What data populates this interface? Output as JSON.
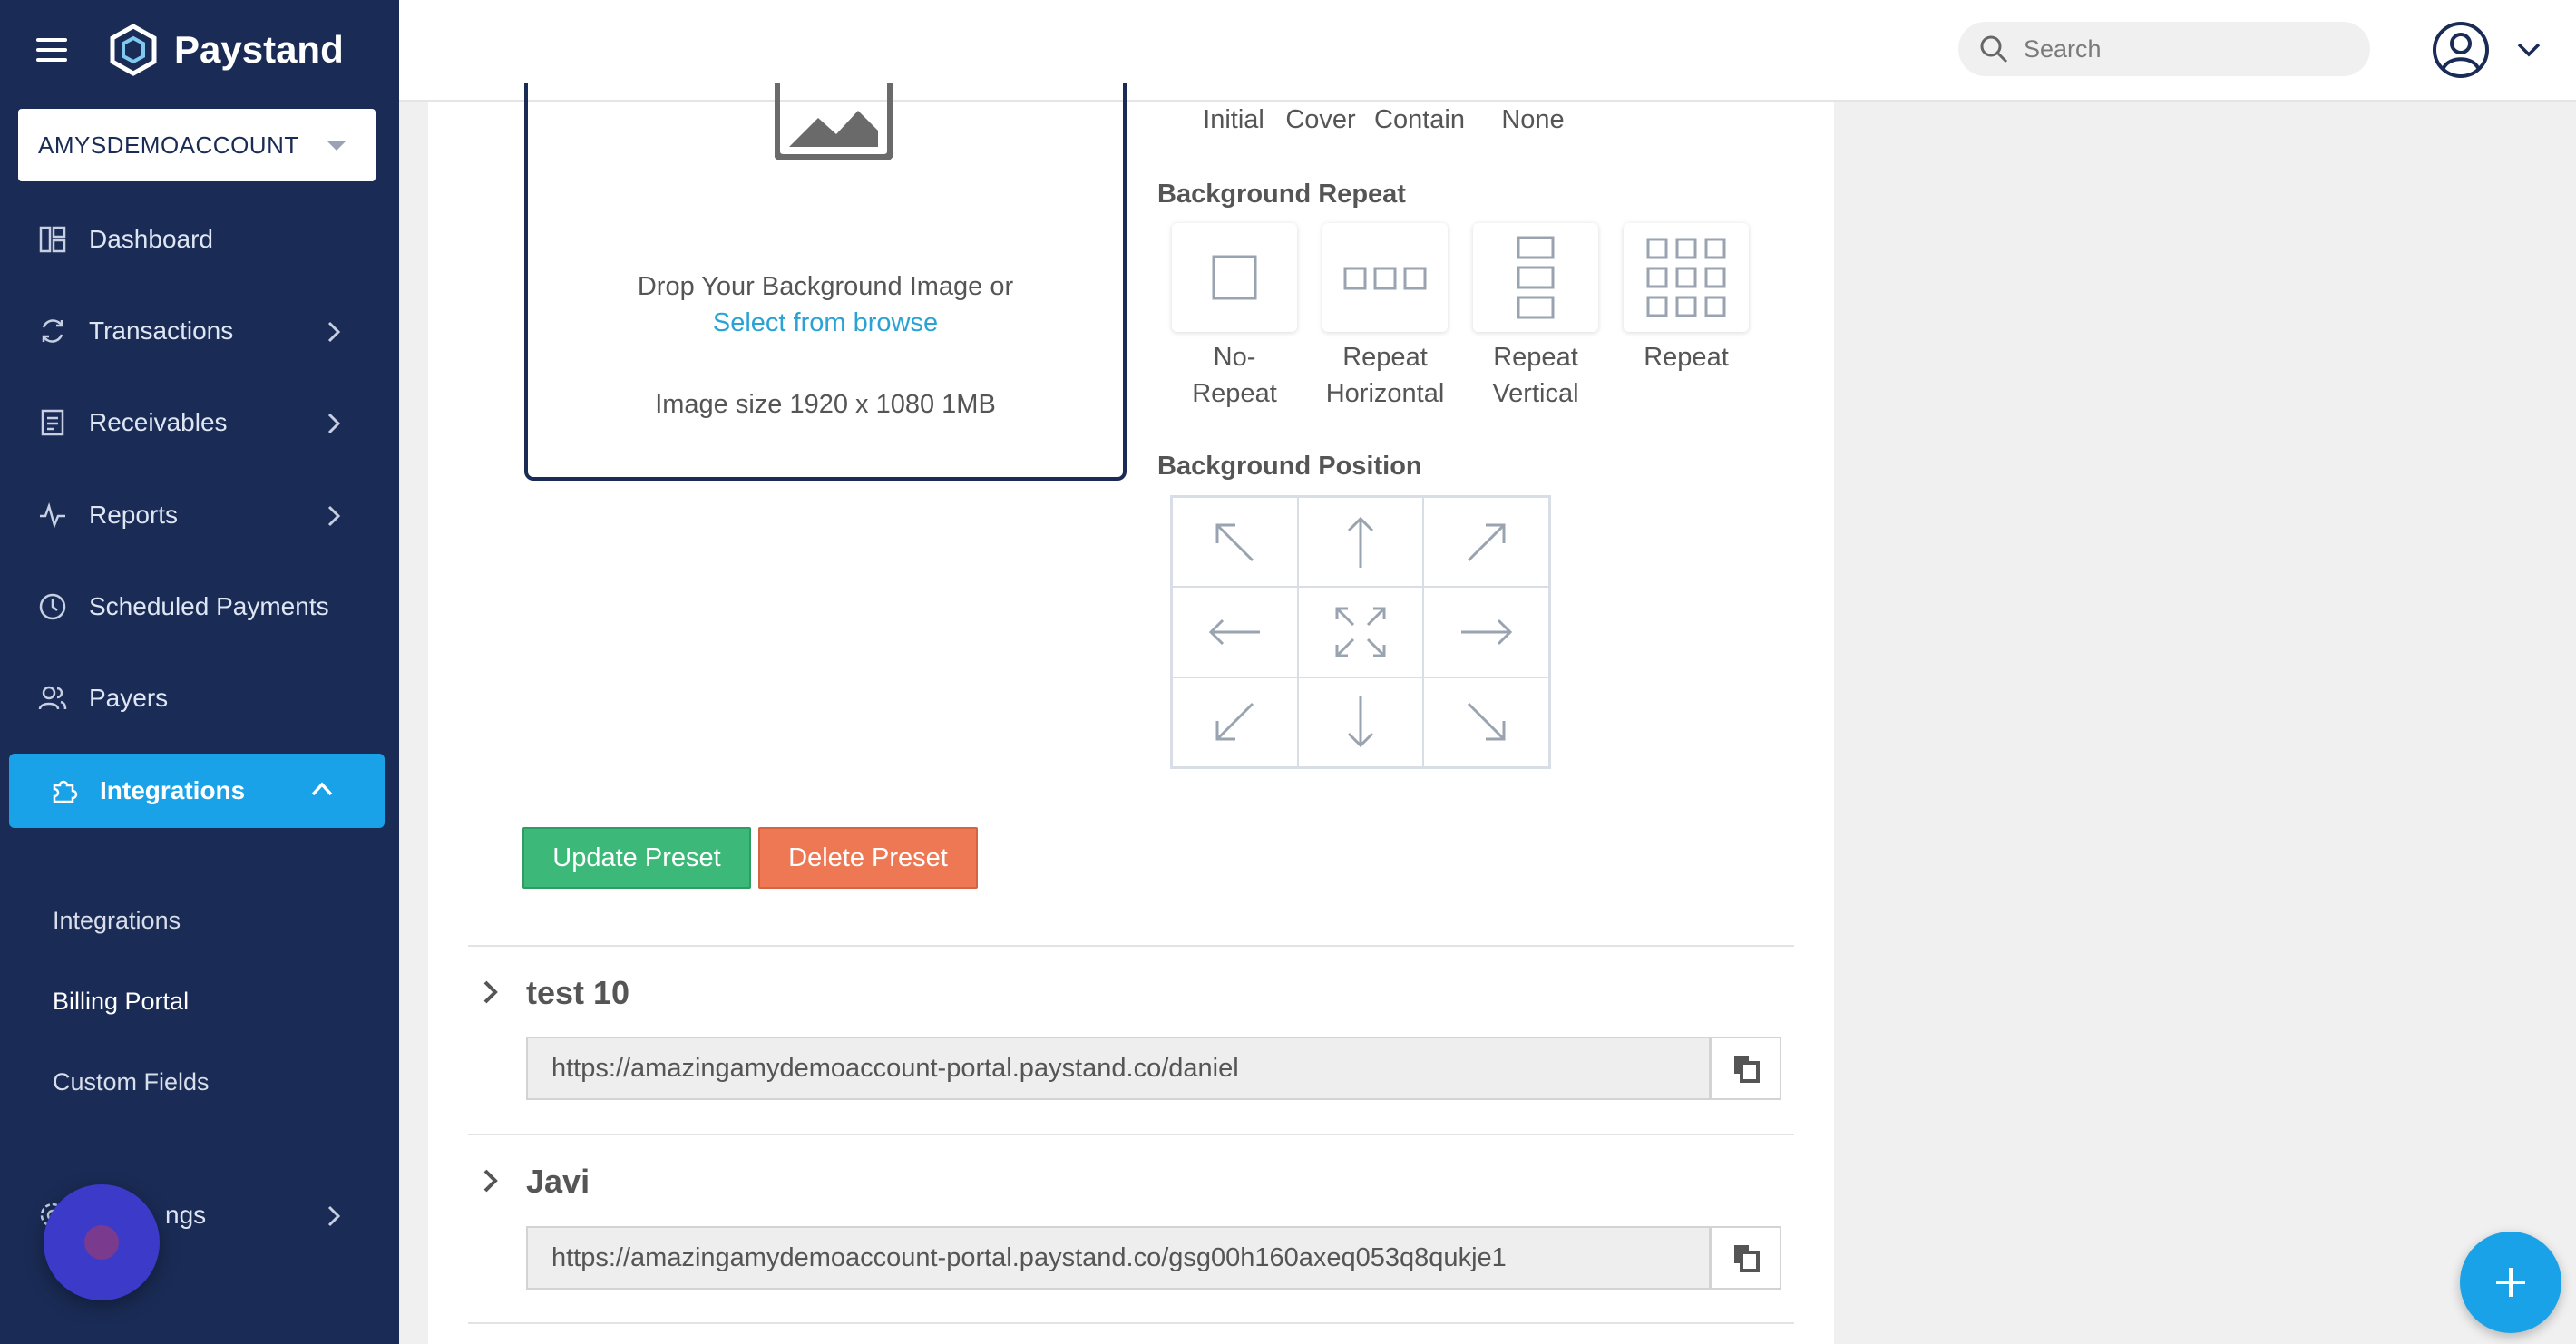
{
  "app": {
    "name": "Paystand"
  },
  "account": {
    "selected": "AMYSDEMOACCOUNT"
  },
  "sidebar": {
    "items": [
      {
        "label": "Dashboard",
        "icon": "dashboard-icon"
      },
      {
        "label": "Transactions",
        "icon": "refresh-icon"
      },
      {
        "label": "Receivables",
        "icon": "document-icon"
      },
      {
        "label": "Reports",
        "icon": "activity-icon"
      },
      {
        "label": "Scheduled Payments",
        "icon": "clock-icon"
      },
      {
        "label": "Payers",
        "icon": "users-icon"
      },
      {
        "label": "Integrations",
        "icon": "puzzle-icon"
      },
      {
        "label": "ngs",
        "icon": "gear-icon"
      }
    ],
    "sub_items": [
      "Integrations",
      "Billing Portal",
      "Custom Fields"
    ],
    "active_item": "Integrations",
    "current_sub_item": "Billing Portal"
  },
  "header": {
    "search_placeholder": "Search"
  },
  "dropzone": {
    "text": "Drop Your Background Image or",
    "link": "Select from browse",
    "size_note": "Image size 1920 x 1080 1MB"
  },
  "background_size": {
    "options": [
      "Initial",
      "Cover",
      "Contain",
      "None"
    ]
  },
  "background_repeat": {
    "title": "Background Repeat",
    "options": [
      {
        "line1": "No-",
        "line2": "Repeat"
      },
      {
        "line1": "Repeat",
        "line2": "Horizontal"
      },
      {
        "line1": "Repeat",
        "line2": "Vertical"
      },
      {
        "line1": "Repeat",
        "line2": ""
      }
    ]
  },
  "background_position": {
    "title": "Background Position"
  },
  "actions": {
    "update": "Update Preset",
    "delete": "Delete Preset"
  },
  "presets": [
    {
      "name": "test 10",
      "url": "https://amazingamydemoaccount-portal.paystand.co/daniel"
    },
    {
      "name": "Javi",
      "url": "https://amazingamydemoaccount-portal.paystand.co/gsg00h160axeq053q8qukje1"
    }
  ],
  "colors": {
    "sidebar": "#1a2b55",
    "accent": "#1aa2e8",
    "update": "#3cb878",
    "delete": "#ee7853"
  }
}
